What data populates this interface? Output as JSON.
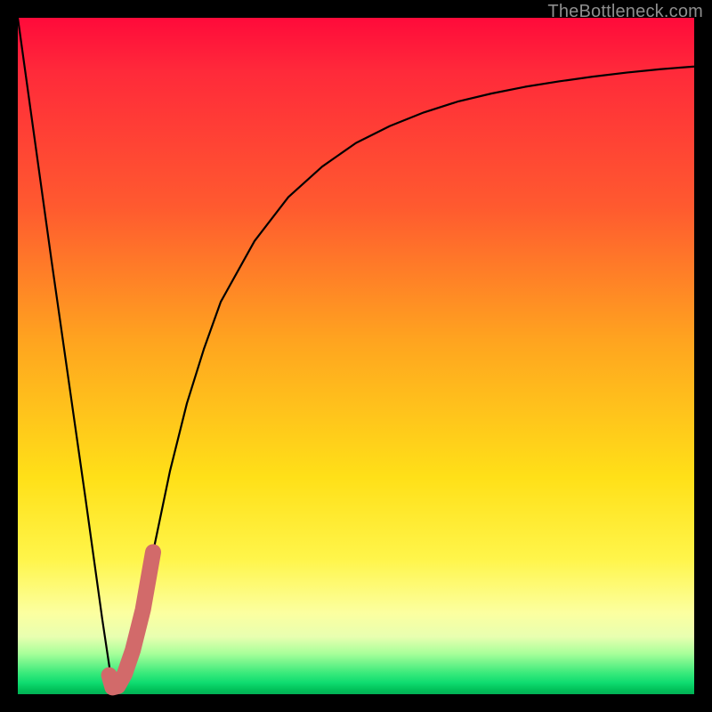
{
  "attribution": "TheBottleneck.com",
  "colors": {
    "frame": "#000000",
    "curve": "#000000",
    "highlight": "#d26a6a",
    "gradient_top": "#ff0a3a",
    "gradient_mid": "#ffe018",
    "gradient_bottom": "#02b056"
  },
  "chart_data": {
    "type": "line",
    "title": "",
    "xlabel": "",
    "ylabel": "",
    "xlim": [
      0,
      100
    ],
    "ylim": [
      0,
      100
    ],
    "grid": false,
    "legend": false,
    "series": [
      {
        "name": "bottleneck-curve",
        "x": [
          0,
          5,
          10,
          12.5,
          14,
          16,
          18,
          20,
          22.5,
          25,
          27.5,
          30,
          35,
          40,
          45,
          50,
          55,
          60,
          65,
          70,
          75,
          80,
          85,
          90,
          95,
          100
        ],
        "values": [
          100,
          64,
          29,
          11,
          1,
          3,
          11,
          21,
          33,
          43,
          51,
          58,
          67,
          73.5,
          78,
          81.5,
          84,
          86,
          87.6,
          88.8,
          89.8,
          90.6,
          91.3,
          91.9,
          92.4,
          92.8
        ]
      },
      {
        "name": "highlight-segment",
        "x": [
          13.5,
          14,
          14.8,
          15.8,
          17,
          18.5,
          20
        ],
        "values": [
          2.8,
          1.0,
          1.2,
          3.0,
          6.5,
          12.5,
          21
        ]
      }
    ],
    "annotations": [
      {
        "text": "TheBottleneck.com",
        "position": "top-right"
      }
    ]
  }
}
